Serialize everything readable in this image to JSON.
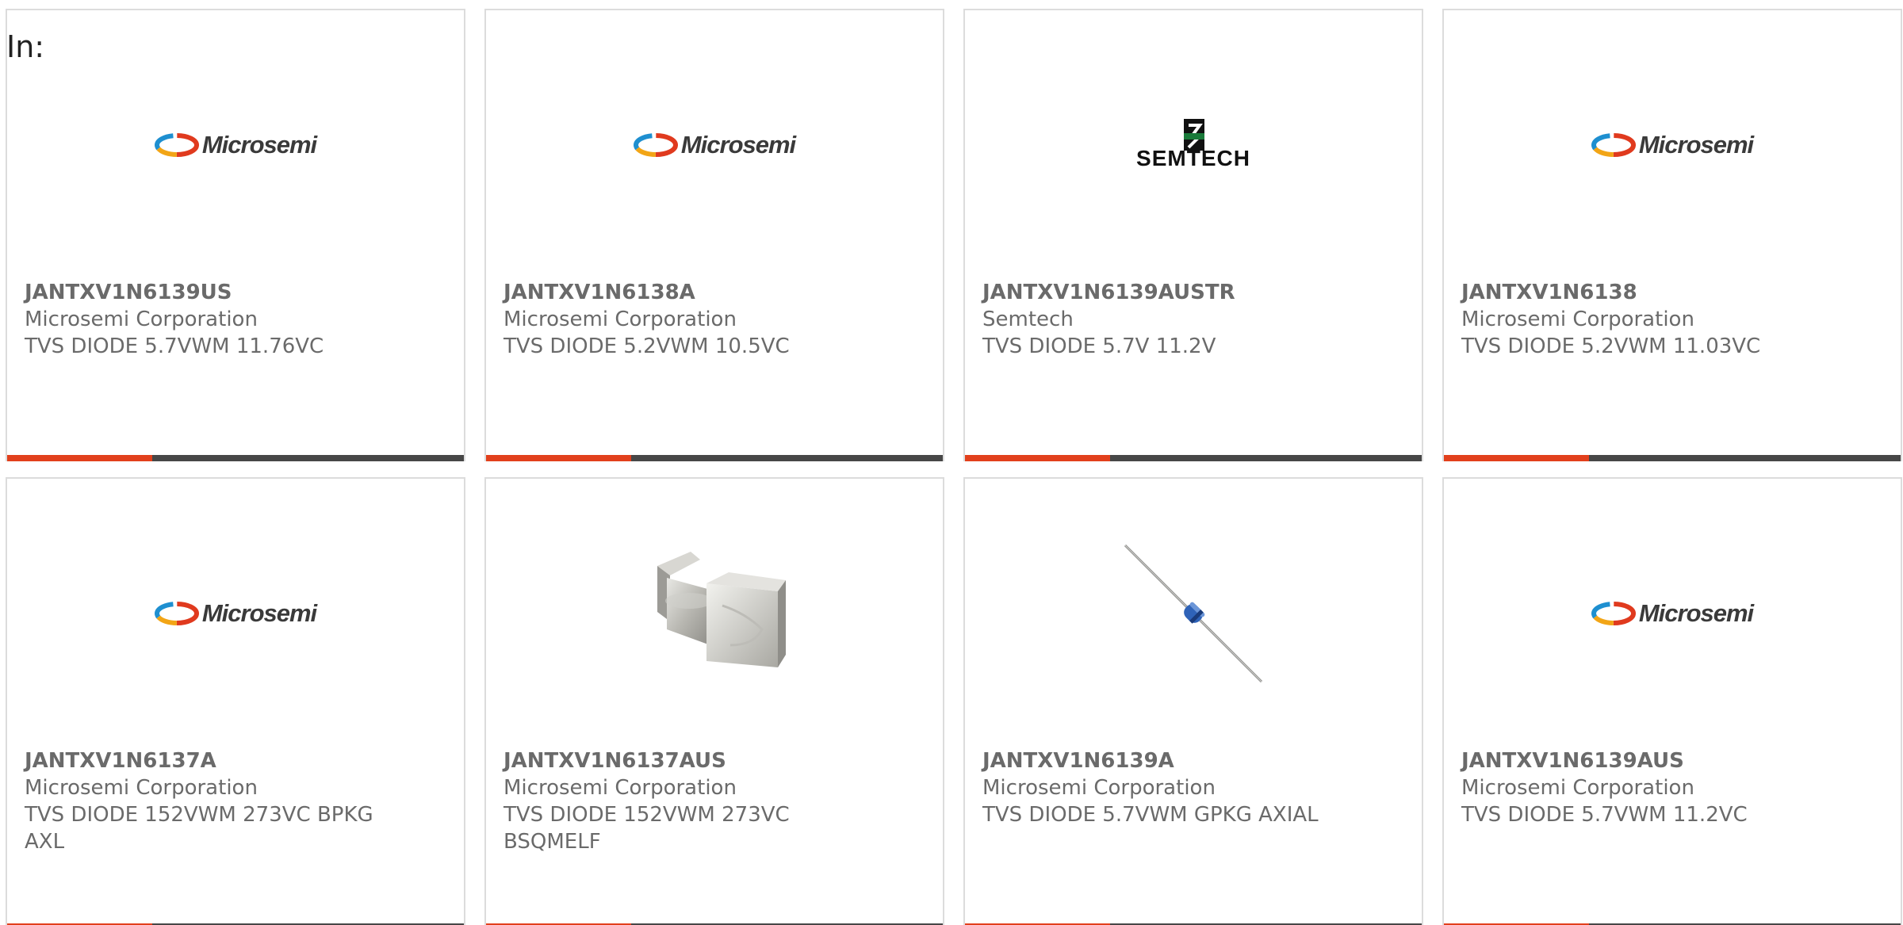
{
  "header": {
    "in_label": "In:"
  },
  "colors": {
    "accent": "#e2401c",
    "bar": "#474747",
    "border": "#dcdcdc",
    "text": "#6a6a6a"
  },
  "products": [
    {
      "part_number": "JANTXV1N6139US",
      "manufacturer": "Microsemi Corporation",
      "description": "TVS DIODE 5.7VWM 11.76VC",
      "image": "microsemi-logo",
      "logo_text": "Microsemi"
    },
    {
      "part_number": "JANTXV1N6138A",
      "manufacturer": "Microsemi Corporation",
      "description": "TVS DIODE 5.2VWM 10.5VC",
      "image": "microsemi-logo",
      "logo_text": "Microsemi"
    },
    {
      "part_number": "JANTXV1N6139AUSTR",
      "manufacturer": "Semtech",
      "description": "TVS DIODE 5.7V 11.2V",
      "image": "semtech-logo",
      "logo_text": "SEMTECH"
    },
    {
      "part_number": "JANTXV1N6138",
      "manufacturer": "Microsemi Corporation",
      "description": "TVS DIODE 5.2VWM 11.03VC",
      "image": "microsemi-logo",
      "logo_text": "Microsemi"
    },
    {
      "part_number": "JANTXV1N6137A",
      "manufacturer": "Microsemi Corporation",
      "description": "TVS DIODE 152VWM 273VC BPKG AXL",
      "image": "microsemi-logo",
      "logo_text": "Microsemi"
    },
    {
      "part_number": "JANTXV1N6137AUS",
      "manufacturer": "Microsemi Corporation",
      "description": "TVS DIODE 152VWM 273VC BSQMELF",
      "image": "square-melf-component-photo"
    },
    {
      "part_number": "JANTXV1N6139A",
      "manufacturer": "Microsemi Corporation",
      "description": "TVS DIODE 5.7VWM GPKG AXIAL",
      "image": "axial-diode-photo"
    },
    {
      "part_number": "JANTXV1N6139AUS",
      "manufacturer": "Microsemi Corporation",
      "description": "TVS DIODE 5.7VWM 11.2VC",
      "image": "microsemi-logo",
      "logo_text": "Microsemi"
    }
  ]
}
